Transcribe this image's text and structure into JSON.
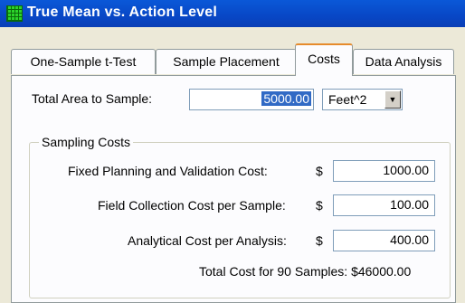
{
  "window": {
    "title": "True Mean vs. Action Level"
  },
  "tabs": [
    {
      "label": "One-Sample t-Test"
    },
    {
      "label": "Sample Placement"
    },
    {
      "label": "Costs"
    },
    {
      "label": "Data Analysis"
    }
  ],
  "area": {
    "label": "Total Area to Sample:",
    "value": "5000.00",
    "unit": "Feet^2"
  },
  "sampling_costs": {
    "title": "Sampling Costs",
    "fixed_label": "Fixed Planning and Validation Cost:",
    "fixed_currency": "$",
    "fixed_value": "1000.00",
    "field_label": "Field Collection Cost per Sample:",
    "field_currency": "$",
    "field_value": "100.00",
    "analytical_label": "Analytical Cost per Analysis:",
    "analytical_currency": "$",
    "analytical_value": "400.00",
    "total_text": "Total Cost for 90 Samples: $46000.00"
  },
  "icons": {
    "app": "grid-app-icon",
    "dropdown": "chevron-down-icon"
  },
  "colors": {
    "titlebar": "#0a58d8",
    "active_tab_accent": "#e68b2c",
    "selection": "#316ac5"
  }
}
